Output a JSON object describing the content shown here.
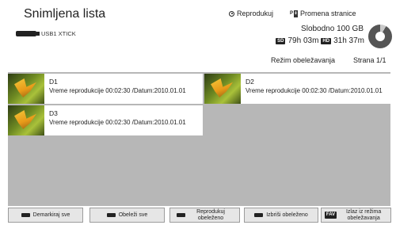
{
  "header": {
    "title": "Snimljena lista",
    "device": "USB1 XTICK",
    "play_label": "Reprodukuj",
    "page_change_key": "P",
    "page_change_label": "Promena stranice",
    "free_space": "Slobodno 100 GB",
    "sd_badge": "SD",
    "sd_time": "79h 03m",
    "hd_badge": "HD",
    "hd_time": "31h 37m",
    "mode_label": "Režim obeležavanja",
    "page_label": "Strana 1/1"
  },
  "items": [
    {
      "name": "D1",
      "info": "Vreme reprodukcije 00:02:30 /Datum:2010.01.01",
      "selected": true
    },
    {
      "name": "D2",
      "info": "Vreme reprodukcije 00:02:30 /Datum:2010.01.01",
      "selected": true
    },
    {
      "name": "D3",
      "info": "Vreme reprodukcije 00:02:30 /Datum:2010.01.01",
      "selected": true
    }
  ],
  "footer": {
    "unmark_all": "Demarkiraj sve",
    "mark_all": "Obeleži sve",
    "play_marked": "Reprodukuj obeleženo",
    "delete_marked": "Izbriši obeleženo",
    "fav_key": "FAV",
    "exit_mode": "Izlaz iz režima obeležavanja"
  }
}
